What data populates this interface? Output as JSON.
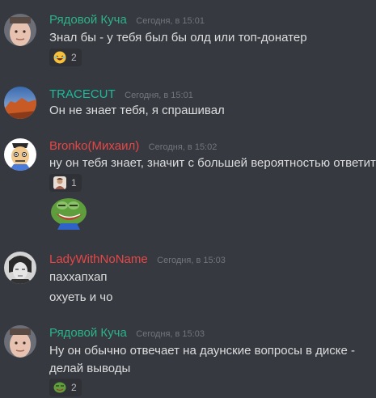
{
  "colors": {
    "background": "#36393f",
    "author_green": "#2bb38a",
    "author_red": "#e84646",
    "author_teal": "#1abc9c",
    "timestamp": "#72767d",
    "text": "#dcddde",
    "reaction_bg": "#2f3136"
  },
  "messages": [
    {
      "author": "Рядовой Куча",
      "timestamp": "Сегодня, в 15:01",
      "lines": [
        "Знал бы - у тебя был бы олд или топ-донатер"
      ],
      "reaction": {
        "icon": "laughing-emoji-icon",
        "count": "2"
      }
    },
    {
      "author": "TRACECUT",
      "timestamp": "Сегодня, в 15:01",
      "lines": [
        "Он не знает тебя, я спрашивал"
      ]
    },
    {
      "author": "Bronko(Михаил)",
      "timestamp": "Сегодня, в 15:02",
      "lines": [
        "ну он тебя знает, значит с большей вероятностью ответит"
      ],
      "reaction": {
        "icon": "person-emoji-icon",
        "count": "1"
      },
      "attachment": "pepe-laughing-sticker"
    },
    {
      "author": "LadyWithNoName",
      "timestamp": "Сегодня, в 15:03",
      "lines": [
        "паххапхап",
        "охуеть и чо"
      ]
    },
    {
      "author": "Рядовой Куча",
      "timestamp": "Сегодня, в 15:03",
      "lines": [
        "Ну он обычно отвечает на даунские вопросы в диске -",
        "делай выводы"
      ],
      "reaction": {
        "icon": "pepe-emoji-icon",
        "count": "2"
      }
    }
  ]
}
